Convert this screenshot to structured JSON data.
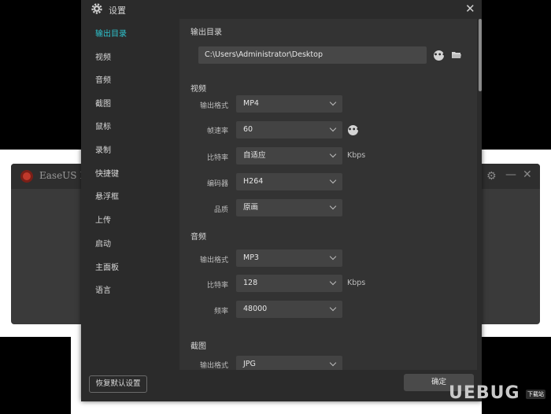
{
  "background_app": {
    "title": "EaseUS Re"
  },
  "dialog": {
    "title": "设置",
    "close_glyph": "✕"
  },
  "sidebar": {
    "items": [
      {
        "label": "输出目录",
        "active": true
      },
      {
        "label": "视频",
        "active": false
      },
      {
        "label": "音频",
        "active": false
      },
      {
        "label": "截图",
        "active": false
      },
      {
        "label": "鼠标",
        "active": false
      },
      {
        "label": "录制",
        "active": false
      },
      {
        "label": "快捷键",
        "active": false
      },
      {
        "label": "悬浮框",
        "active": false
      },
      {
        "label": "上传",
        "active": false
      },
      {
        "label": "启动",
        "active": false
      },
      {
        "label": "主面板",
        "active": false
      },
      {
        "label": "语言",
        "active": false
      }
    ]
  },
  "output_dir": {
    "heading": "输出目录",
    "path": "C:\\Users\\Administrator\\Desktop",
    "more_glyph": "•••"
  },
  "video": {
    "heading": "视频",
    "format": {
      "label": "输出格式",
      "value": "MP4"
    },
    "fps": {
      "label": "帧速率",
      "value": "60"
    },
    "bitrate": {
      "label": "比特率",
      "value": "自适应",
      "unit": "Kbps"
    },
    "encoder": {
      "label": "编码器",
      "value": "H264"
    },
    "quality": {
      "label": "品质",
      "value": "原画"
    }
  },
  "audio": {
    "heading": "音频",
    "format": {
      "label": "输出格式",
      "value": "MP3"
    },
    "bitrate": {
      "label": "比特率",
      "value": "128",
      "unit": "Kbps"
    },
    "frequency": {
      "label": "频率",
      "value": "48000"
    }
  },
  "screenshot": {
    "heading": "截图",
    "format": {
      "label": "输出格式",
      "value": "JPG"
    }
  },
  "footer": {
    "reset_label": "恢复默认设置",
    "ok_label": "确定"
  },
  "watermark": {
    "text": "UEBUG",
    "badge": "下载站"
  },
  "colors": {
    "accent": "#2ec4cf",
    "dialog_bg": "#2b2b2b",
    "content_bg": "#333333",
    "control_bg": "#434343"
  }
}
